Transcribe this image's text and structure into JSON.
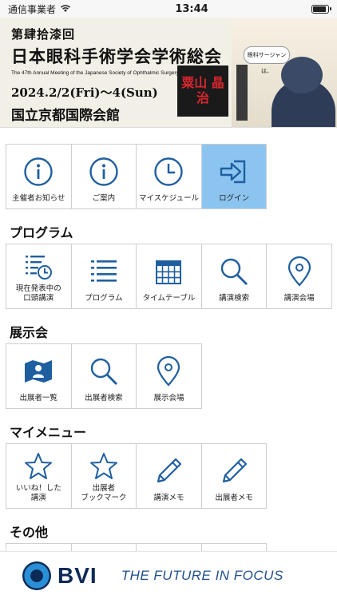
{
  "status_bar": {
    "carrier": "通信事業者",
    "time": "13:44"
  },
  "banner": {
    "edition": "第肆拾漆回",
    "title": "日本眼科手術学会学術総会",
    "subtitle": "The 47th Annual Meeting of the Japanese Society of Ophthalmic Surgery",
    "date": "2024.2/2(Fri)～4(Sun)",
    "venue": "国立京都国際会館",
    "stamp": "粟山 晶治",
    "speech": "眼科サージャンは、"
  },
  "top_menu": [
    {
      "label": "主催者お知らせ",
      "icon": "info-icon"
    },
    {
      "label": "ご案内",
      "icon": "info-icon"
    },
    {
      "label": "マイスケジュール",
      "icon": "clock-icon"
    },
    {
      "label": "ログイン",
      "icon": "login-icon",
      "active": true
    }
  ],
  "sections": {
    "program": {
      "title": "プログラム",
      "items": [
        {
          "label1": "現在発表中の",
          "label2": "口頭講演",
          "icon": "list-clock-icon"
        },
        {
          "label1": "プログラム",
          "icon": "list-icon"
        },
        {
          "label1": "タイムテーブル",
          "icon": "calendar-icon"
        },
        {
          "label1": "講演検索",
          "icon": "search-icon"
        },
        {
          "label1": "講演会場",
          "icon": "map-pin-icon"
        }
      ]
    },
    "exhibition": {
      "title": "展示会",
      "items": [
        {
          "label1": "出展者一覧",
          "icon": "exhibitor-map-icon"
        },
        {
          "label1": "出展者検索",
          "icon": "search-icon"
        },
        {
          "label1": "展示会場",
          "icon": "map-pin-icon"
        }
      ]
    },
    "my_menu": {
      "title": "マイメニュー",
      "items": [
        {
          "label1": "いいね！した",
          "label2": "講演",
          "icon": "star-icon"
        },
        {
          "label1": "出展者",
          "label2": "ブックマーク",
          "icon": "star-icon"
        },
        {
          "label1": "講演メモ",
          "icon": "pencil-icon"
        },
        {
          "label1": "出展者メモ",
          "icon": "pencil-icon"
        }
      ]
    },
    "other": {
      "title": "その他"
    }
  },
  "ad": {
    "brand": "BVI",
    "tagline": "THE FUTURE IN FOCUS"
  },
  "colors": {
    "icon_blue": "#1f5fa0",
    "active_tile": "#8cc4f0"
  }
}
